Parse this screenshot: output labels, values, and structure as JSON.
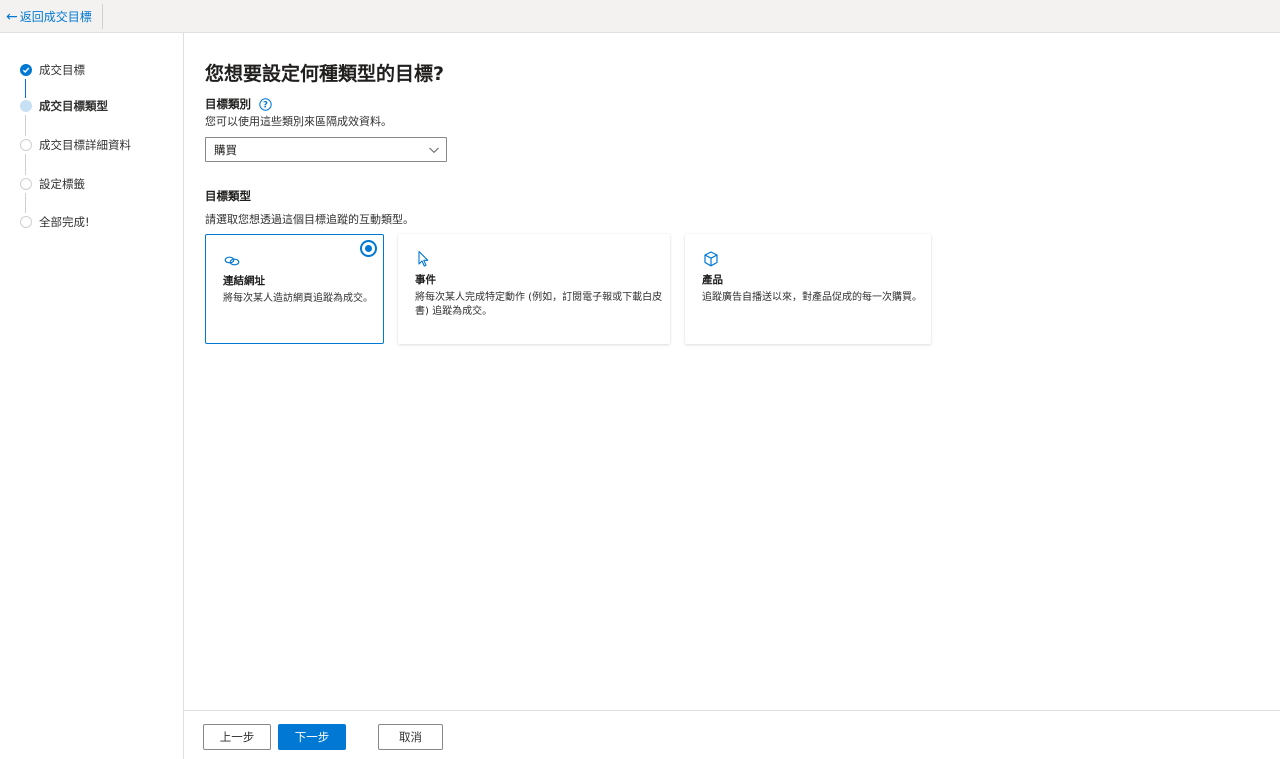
{
  "topbar": {
    "back_label": "返回成交目標"
  },
  "steps": [
    {
      "label": "成交目標",
      "state": "done"
    },
    {
      "label": "成交目標類型",
      "state": "current"
    },
    {
      "label": "成交目標詳細資料",
      "state": "todo"
    },
    {
      "label": "設定標籤",
      "state": "todo"
    },
    {
      "label": "全部完成!",
      "state": "todo"
    }
  ],
  "main": {
    "heading": "您想要設定何種類型的目標?",
    "category_label": "目標類別",
    "category_desc": "您可以使用這些類別來區隔成效資料。",
    "category_value": "購買",
    "type_label": "目標類型",
    "type_desc": "請選取您想透過這個目標追蹤的互動類型。",
    "cards": [
      {
        "icon": "link-icon",
        "title": "連結網址",
        "desc_lines": [
          "將每次某人造訪網頁追蹤為成交。"
        ],
        "selected": true
      },
      {
        "icon": "cursor-icon",
        "title": "事件",
        "desc_lines": [
          "將每次某人完成特定動作 (例如，訂閱電子報或下載白皮",
          "書) 追蹤為成交。"
        ],
        "selected": false
      },
      {
        "icon": "cube-icon",
        "title": "產品",
        "desc_lines": [
          "追蹤廣告自播送以來，對產品促成的每一次購買。"
        ],
        "selected": false
      }
    ]
  },
  "footer": {
    "prev_label": "上一步",
    "next_label": "下一步",
    "cancel_label": "取消"
  },
  "colors": {
    "accent": "#0078d4",
    "topbar_bg": "#f3f2f1"
  }
}
